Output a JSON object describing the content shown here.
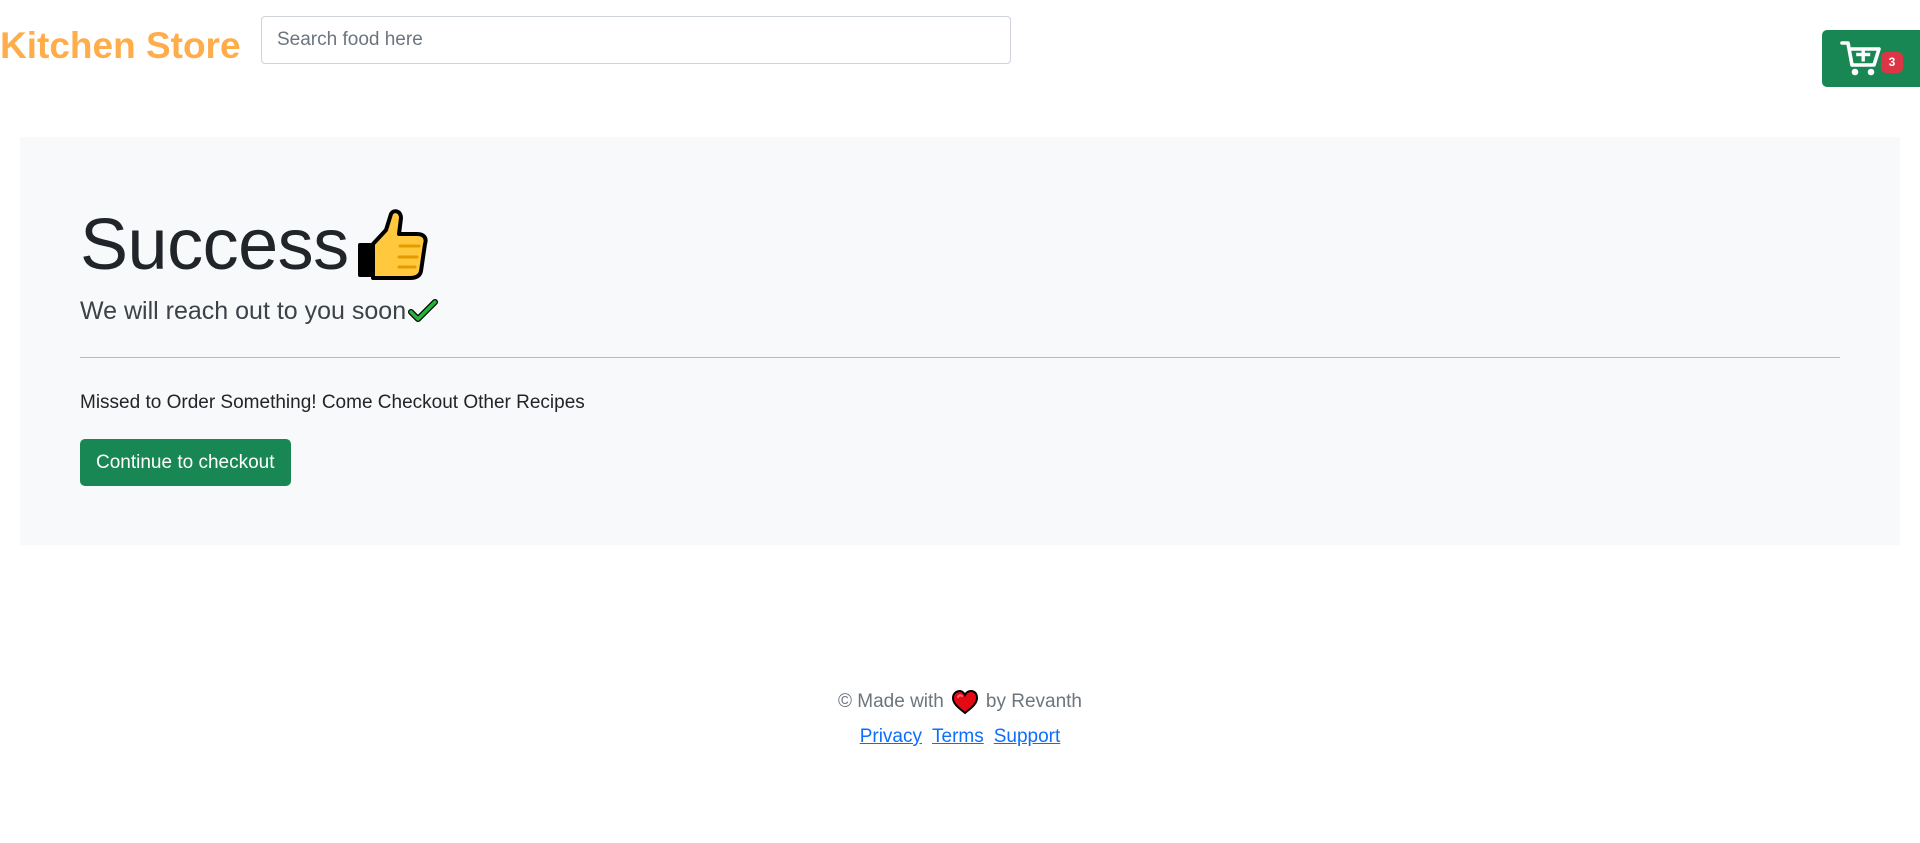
{
  "header": {
    "brand": "Kitchen Store",
    "search": {
      "placeholder": "Search food here",
      "value": ""
    },
    "cart": {
      "icon": "cart-plus-icon",
      "badge_count": "3"
    }
  },
  "main": {
    "title": "Success",
    "title_icon": "thumbs-up-icon",
    "subtitle": "We will reach out to you soon",
    "subtitle_icon": "check-icon",
    "lead": "Missed to Order Something! Come Checkout Other Recipes",
    "button_label": "Continue to checkout"
  },
  "footer": {
    "copyright_prefix": "© Made with",
    "heart_icon": "heart-icon",
    "copyright_suffix": "by Revanth",
    "links": [
      {
        "label": "Privacy"
      },
      {
        "label": "Terms"
      },
      {
        "label": "Support"
      }
    ]
  },
  "colors": {
    "brand": "#ffad4a",
    "success": "#198754",
    "danger": "#dc3545",
    "link": "#0d6efd",
    "panel": "#f8f9fa"
  }
}
